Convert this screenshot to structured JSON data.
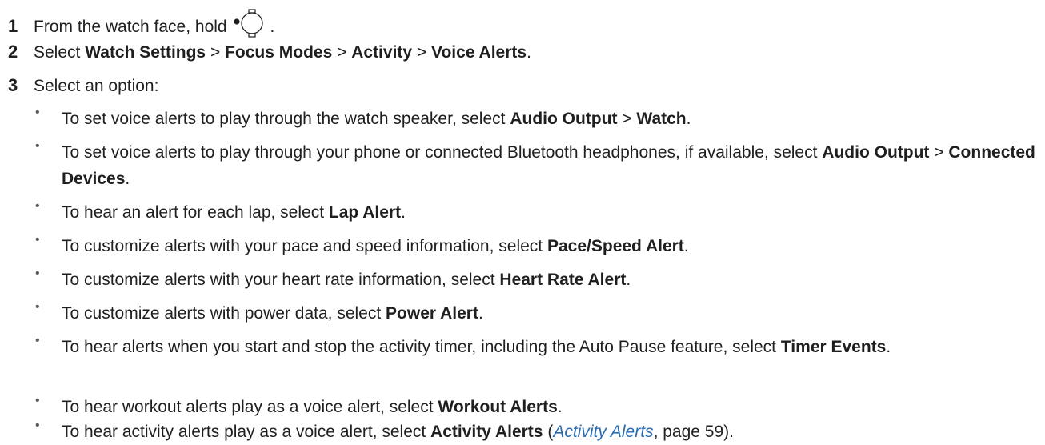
{
  "steps": [
    {
      "num": "1",
      "t1": "From the watch face, hold",
      "t2": "."
    },
    {
      "num": "2",
      "t1": "Select",
      "b1": "Watch Settings",
      "s1": ">",
      "b2": "Focus Modes",
      "s2": ">",
      "b3": "Activity",
      "s3": ">",
      "b4": "Voice Alerts",
      "t2": "."
    },
    {
      "num": "3",
      "t1": "Select an option:"
    }
  ],
  "bullets": [
    {
      "t1": "To set voice alerts to play through the watch speaker, select",
      "b1": "Audio Output",
      "s1": ">",
      "b2": "Watch",
      "t2": "."
    },
    {
      "t1": "To set voice alerts to play through your phone or connected Bluetooth headphones, if available, select",
      "b1": "Audio Output",
      "s1": ">",
      "b2": "Connected Devices",
      "t2": "."
    },
    {
      "t1": "To hear an alert for each lap, select",
      "b1": "Lap Alert",
      "t2": "."
    },
    {
      "t1": "To customize alerts with your pace and speed information, select",
      "b1": "Pace/Speed Alert",
      "t2": "."
    },
    {
      "t1": "To customize alerts with your heart rate information, select",
      "b1": "Heart Rate Alert",
      "t2": "."
    },
    {
      "t1": "To customize alerts with power data, select",
      "b1": "Power Alert",
      "t2": "."
    },
    {
      "t1": "To hear alerts when you start and stop the activity timer, including the Auto Pause feature, select",
      "b1": "Timer Events",
      "t2": "."
    },
    {
      "t1": "To hear workout alerts play as a voice alert, select",
      "b1": "Workout Alerts",
      "t2": "."
    },
    {
      "t1": "To hear activity alerts play as a voice alert, select",
      "b1": "Activity Alerts",
      "t2": " (",
      "link": "Activity Alerts",
      "t3": ", page 59)."
    }
  ],
  "bullet_glyph": "•",
  "icons": {
    "button": "watch-button-icon"
  }
}
